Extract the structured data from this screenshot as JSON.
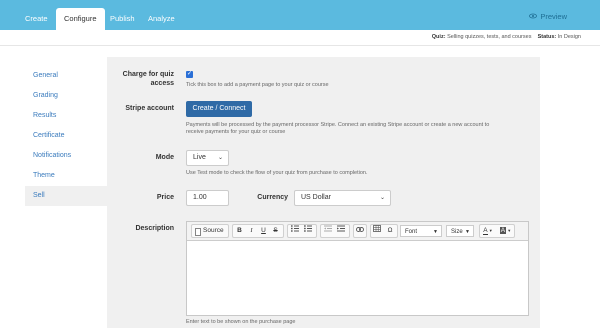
{
  "topbar": {
    "tabs": [
      {
        "label": "Create"
      },
      {
        "label": "Configure"
      },
      {
        "label": "Publish"
      },
      {
        "label": "Analyze"
      }
    ],
    "preview_label": "Preview",
    "preview_icon": "eye-icon"
  },
  "subbar": {
    "quiz_label": "Quiz:",
    "quiz_value": "Selling quizzes, tests, and courses",
    "status_label": "Status:",
    "status_value": "In Design"
  },
  "sidebar": {
    "items": [
      {
        "label": "General"
      },
      {
        "label": "Grading"
      },
      {
        "label": "Results"
      },
      {
        "label": "Certificate"
      },
      {
        "label": "Notifications"
      },
      {
        "label": "Theme"
      },
      {
        "label": "Sell"
      }
    ]
  },
  "form": {
    "charge_label_1": "Charge for quiz",
    "charge_label_2": "access",
    "charge_checked": true,
    "charge_help": "Tick this box to add a payment page to your quiz or course",
    "stripe_label": "Stripe account",
    "stripe_button": "Create / Connect",
    "stripe_help_1": "Payments will be processed by the payment processor Stripe. Connect an existing Stripe account or create a new account to",
    "stripe_help_2": "receive payments for your quiz or course",
    "mode_label": "Mode",
    "mode_value": "Live",
    "mode_help": "Use Test mode to check the flow of your quiz from purchase to completion.",
    "price_label": "Price",
    "price_value": "1.00",
    "currency_label": "Currency",
    "currency_value": "US Dollar",
    "description_label": "Description",
    "description_help": "Enter text to be shown on the purchase page"
  },
  "editor_toolbar": {
    "source_label": "Source",
    "bold": "B",
    "italic": "I",
    "underline": "U",
    "strike": "S",
    "font_label": "Font",
    "size_label": "Size",
    "text_color": "A",
    "bg_color": "A",
    "special_char": "Ω"
  },
  "colors": {
    "topbar": "#5bbadf",
    "primary_button": "#2f6aa6",
    "link": "#3a7bbd",
    "panel": "#f0f0f0"
  }
}
